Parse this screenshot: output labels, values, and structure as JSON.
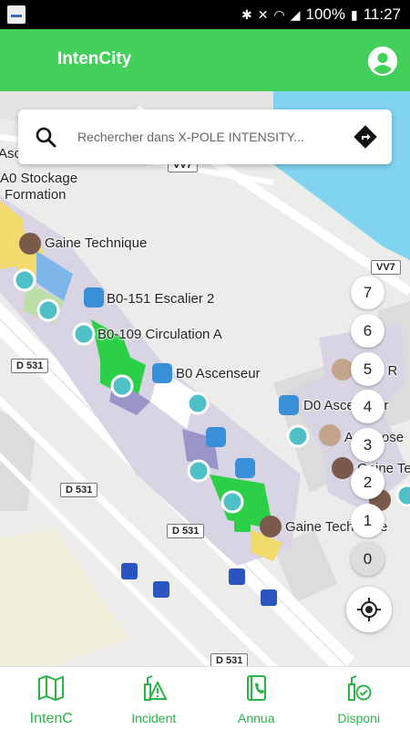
{
  "status_bar": {
    "battery": "100%",
    "time": "11:27"
  },
  "app_bar": {
    "title": "IntenCity"
  },
  "search": {
    "placeholder": "Rechercher dans X-POLE INTENSITY..."
  },
  "map": {
    "labels": {
      "ascenseur_partial": "Ascen",
      "stockage": "A0 Stockage",
      "formation": "Formation",
      "gaine_technique_1": "Gaine Technique",
      "escalier": "B0-151 Escalier 2",
      "circulation": "B0-109 Circulation A",
      "b0_ascenseur": "B0 Ascenseur",
      "d0_ascenseur": "D0 Ascenseur",
      "salle": "Salle R",
      "a_repose": "A Repose",
      "gaine_tech_partial": "Gaine Tech",
      "gaine_technique_2": "Gaine Technique"
    },
    "roads": {
      "vv_top": "VV7",
      "vv7": "VV7",
      "d531_a": "D 531",
      "d531_b": "D 531",
      "d531_c": "D 531",
      "d531_d": "D 531"
    }
  },
  "floors": [
    "7",
    "6",
    "5",
    "4",
    "3",
    "2",
    "1",
    "0"
  ],
  "active_floor": "0",
  "bottom_nav": {
    "items": [
      {
        "label": "IntenC",
        "icon": "map-icon"
      },
      {
        "label": "Incident",
        "icon": "incident-icon"
      },
      {
        "label": "Annua",
        "icon": "directory-icon"
      },
      {
        "label": "Disponi",
        "icon": "availability-icon"
      }
    ],
    "active_index": 0
  },
  "colors": {
    "brand_green": "#43d05a",
    "nav_green": "#2bb548",
    "water": "#80d4ef",
    "poi_teal": "#4fc1c6",
    "poi_blue": "#3a8fd9",
    "room_green": "#2bd046",
    "room_purple": "#9a95c9",
    "room_yellow": "#f3da6c",
    "bus_blue": "#2a55c0"
  }
}
